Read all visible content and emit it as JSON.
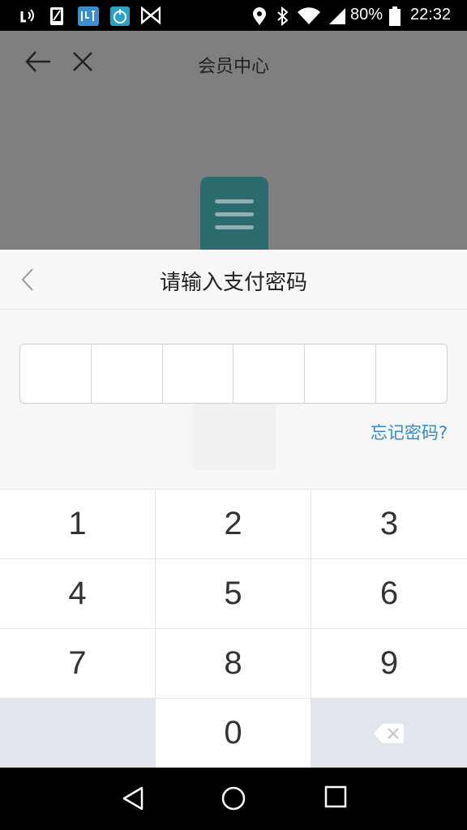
{
  "status_bar": {
    "battery": "80%",
    "time": "22:32"
  },
  "background_page": {
    "title": "会员中心"
  },
  "dialog": {
    "title": "请输入支付密码",
    "forgot_password": "忘记密码?",
    "pin_length": 6
  },
  "keypad": {
    "keys": [
      "1",
      "2",
      "3",
      "4",
      "5",
      "6",
      "7",
      "8",
      "9",
      "0"
    ]
  },
  "icons": {
    "status": [
      "nfc-icon",
      "phone-icon",
      "app-icon",
      "timer-icon",
      "bowtie-icon",
      "location-icon",
      "bluetooth-icon",
      "wifi-icon",
      "signal-icon",
      "battery-icon"
    ],
    "nav": [
      "back-triangle-icon",
      "home-circle-icon",
      "recents-square-icon"
    ]
  }
}
